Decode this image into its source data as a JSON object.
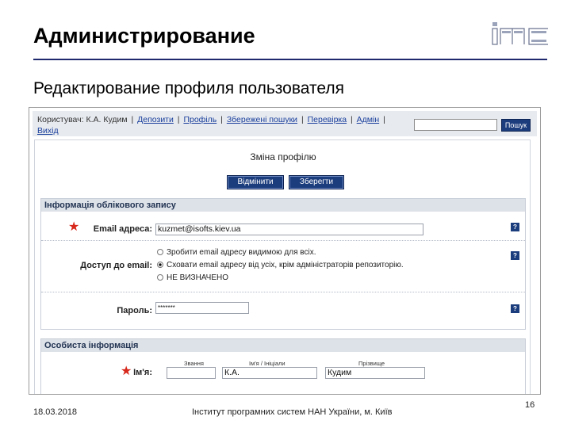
{
  "slide": {
    "title": "Администрирование",
    "subtitle": "Редактирование профиля пользователя",
    "footer_date": "18.03.2018",
    "footer_org": "Інститут програмних систем НАН України, м. Київ",
    "page_number": "16",
    "accent_color": "#1f2a6e",
    "logo_icon": "imc-logo-icon"
  },
  "topbar": {
    "user_prefix": "Користувач: К.А. Кудим",
    "links": [
      "Депозити",
      "Профіль",
      "Збережені пошуки",
      "Перевірка",
      "Адмін"
    ],
    "exit_link": "Вихід",
    "search_value": "",
    "search_button": "Пошук"
  },
  "form": {
    "heading": "Зміна профілю",
    "cancel_button": "Відмінити",
    "save_button": "Зберегти"
  },
  "account_section": {
    "title": "Інформація облікового запису",
    "email_label": "Email адреса:",
    "email_value": "kuzmet@isofts.kiev.ua",
    "email_access_label": "Доступ до email:",
    "email_options": [
      {
        "label": "Зробити email адресу видимою для всіх.",
        "selected": false
      },
      {
        "label": "Сховати email адресу від усіх, крім адміністраторів репозиторію.",
        "selected": true
      },
      {
        "label": "НЕ ВИЗНАЧЕНО",
        "selected": false
      }
    ],
    "password_label": "Пароль:",
    "password_value": "*******",
    "help_glyph": "?"
  },
  "personal_section": {
    "title": "Особиста інформація",
    "name_label": "Ім'я:",
    "col_title": "Звання",
    "col_initials": "Ім'я / Ініціали",
    "col_surname": "Прізвище",
    "title_value": "",
    "initials_value": "К.А.",
    "surname_value": "Кудим"
  }
}
